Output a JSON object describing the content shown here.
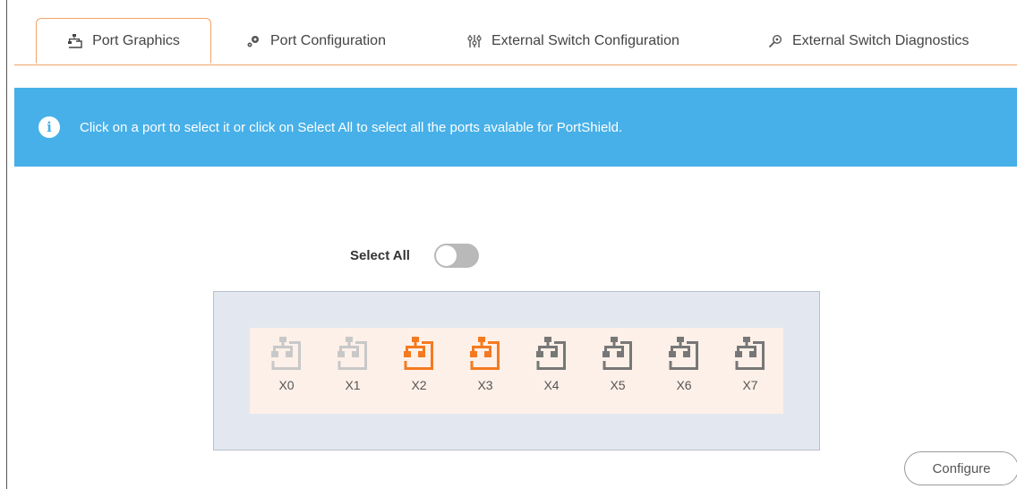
{
  "tabs": [
    {
      "label": "Port Graphics",
      "icon": "port-icon",
      "active": true
    },
    {
      "label": "Port Configuration",
      "icon": "gears-icon",
      "active": false
    },
    {
      "label": "External Switch Configuration",
      "icon": "sliders-icon",
      "active": false
    },
    {
      "label": "External Switch Diagnostics",
      "icon": "magnifier-icon",
      "active": false
    }
  ],
  "banner": {
    "message": "Click on a port to select it or click on Select All to select all the ports avalable for PortShield."
  },
  "select_all": {
    "label": "Select All",
    "checked": false
  },
  "ports": [
    {
      "label": "X0",
      "state": "disabled"
    },
    {
      "label": "X1",
      "state": "disabled"
    },
    {
      "label": "X2",
      "state": "active"
    },
    {
      "label": "X3",
      "state": "active"
    },
    {
      "label": "X4",
      "state": "normal"
    },
    {
      "label": "X5",
      "state": "normal"
    },
    {
      "label": "X6",
      "state": "normal"
    },
    {
      "label": "X7",
      "state": "normal"
    }
  ],
  "colors": {
    "disabled": "#c8c8c8",
    "active": "#f47a20",
    "normal": "#777777",
    "banner": "#47b0e8",
    "tab_border": "#f0a46b"
  },
  "configure_label": "Configure"
}
